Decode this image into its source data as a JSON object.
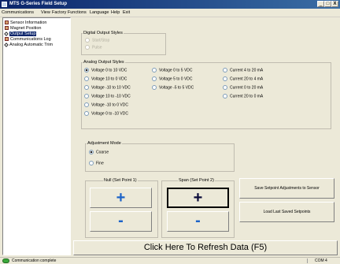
{
  "window": {
    "title": "MTS G-Series Field Setup",
    "minimize": "_",
    "maximize": "□",
    "close": "X"
  },
  "menu": [
    "Communications",
    "View",
    "Factory Functions",
    "Language",
    "Help",
    "Exit"
  ],
  "sidebar": {
    "items": [
      {
        "label": "Sensor Information",
        "icon": "sensor-icon"
      },
      {
        "label": "Magnet Position",
        "icon": "magnet-icon"
      },
      {
        "label": "Output Setup",
        "icon": "pen-icon",
        "selected": true
      },
      {
        "label": "Communications Log",
        "icon": "log-icon"
      },
      {
        "label": "Analog Automatic Trim",
        "icon": "pen-icon"
      }
    ]
  },
  "digital": {
    "title": "Digital Output Styles",
    "options": [
      "Start/Stop",
      "Pulse"
    ]
  },
  "analog": {
    "title": "Analog Output Styles",
    "col1": [
      "Voltage 0 to 10 VDC",
      "Voltage 10 to 0 VDC",
      "Voltage -10 to 10 VDC",
      "Voltage 10 to -10 VDC",
      "Voltage -10 to 0 VDC",
      "Voltage 0 to -10 VDC"
    ],
    "col2": [
      "Voltage 0 to 5 VDC",
      "Voltage 5 to 0 VDC",
      "Voltage -5 to 5 VDC"
    ],
    "col3": [
      "Current 4 to 20 mA",
      "Current 20 to 4 mA",
      "Current 0 to 20 mA",
      "Current 20 to 0 mA"
    ],
    "selected": "Voltage 0 to 10 VDC"
  },
  "adjustment": {
    "title": "Adjustment Mode",
    "options": [
      "Coarse",
      "Fine"
    ],
    "selected": "Coarse"
  },
  "null_group": {
    "title": "Null (Set Point 1)",
    "plus": "+",
    "minus": "-"
  },
  "span_group": {
    "title": "Span (Set Point 2)",
    "plus": "+",
    "minus": "-"
  },
  "actions": {
    "save": "Save Setpoint Adjustments to Sensor",
    "load": "Load Last Saved Setpoints"
  },
  "refresh": "Click Here To Refresh Data (F5)",
  "status": {
    "text": "Communication complete",
    "port": "COM 4",
    "led_color": "#3aa83a"
  }
}
